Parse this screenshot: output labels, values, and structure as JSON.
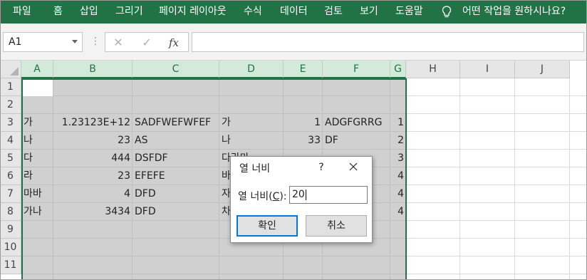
{
  "ribbon": {
    "tabs": [
      "파일",
      "홈",
      "삽입",
      "그리기",
      "페이지 레이아웃",
      "수식",
      "데이터",
      "검토",
      "보기",
      "도움말"
    ],
    "tell_me": "어떤 작업을 원하시나요?",
    "bg_color": "#217346"
  },
  "formula_bar": {
    "name_box": "A1",
    "fx_label": "fx",
    "formula": ""
  },
  "grid": {
    "columns": [
      "A",
      "B",
      "C",
      "D",
      "E",
      "F",
      "G",
      "H",
      "I",
      "J"
    ],
    "selected_columns": [
      "A",
      "B",
      "C",
      "D",
      "E",
      "F",
      "G"
    ],
    "rows": [
      "1",
      "2",
      "3",
      "4",
      "5",
      "6",
      "7",
      "8",
      "9",
      "10",
      "11"
    ],
    "cells": {
      "r3": [
        "가",
        "1.23123E+12",
        "SADFWEFWFEF",
        "가",
        "1",
        "ADGFGRRG",
        "1"
      ],
      "r4": [
        "나",
        "23",
        "AS",
        "나",
        "33",
        "DF",
        "2"
      ],
      "r5": [
        "다",
        "444",
        "DSFDF",
        "다라마",
        "",
        "",
        "3"
      ],
      "r6": [
        "라",
        "23",
        "EFEFE",
        "바",
        "",
        "",
        "4"
      ],
      "r7": [
        "마바",
        "4",
        "DFD",
        "자",
        "",
        "",
        "4"
      ],
      "r8": [
        "가나",
        "3434",
        "DFD",
        "차",
        "",
        "",
        "4"
      ]
    },
    "selection_color": "#d0d0d0",
    "accent": "#217346"
  },
  "dialog": {
    "title": "열 너비",
    "help": "?",
    "field_label": "열 너비(",
    "field_hotkey": "C",
    "field_label_end": "):",
    "field_value": "20",
    "ok_label": "확인",
    "cancel_label": "취소"
  }
}
